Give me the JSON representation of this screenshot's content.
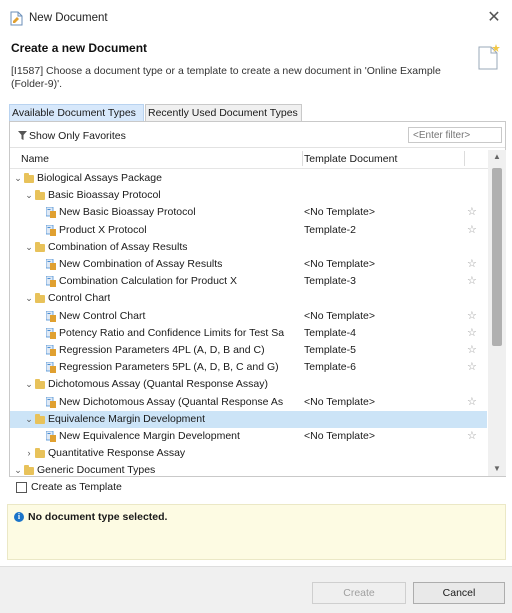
{
  "window": {
    "title": "New Document",
    "close_glyph": "✕"
  },
  "header": {
    "title": "Create a new Document",
    "description": "[I1587] Choose a document type or a template to create a new document in 'Online Example (Folder-9)'."
  },
  "tabs": [
    {
      "label": "Available Document Types",
      "active": true
    },
    {
      "label": "Recently Used Document Types",
      "active": false
    }
  ],
  "favorites": {
    "label": "Show Only Favorites",
    "filter_placeholder": "<Enter filter>"
  },
  "columns": {
    "name": "Name",
    "template": "Template Document"
  },
  "tree": [
    {
      "type": "folder",
      "level": 0,
      "label": "Biological Assays Package",
      "expanded": true
    },
    {
      "type": "folder",
      "level": 1,
      "label": "Basic Bioassay Protocol",
      "expanded": true
    },
    {
      "type": "doc",
      "level": 2,
      "label": "New Basic Bioassay Protocol",
      "template": "<No Template>",
      "star": "☆"
    },
    {
      "type": "doc",
      "level": 2,
      "label": "Product X Protocol",
      "template": "Template-2",
      "star": "☆"
    },
    {
      "type": "folder",
      "level": 1,
      "label": "Combination of Assay Results",
      "expanded": true
    },
    {
      "type": "doc",
      "level": 2,
      "label": "New Combination of Assay Results",
      "template": "<No Template>",
      "star": "☆"
    },
    {
      "type": "doc",
      "level": 2,
      "label": "Combination Calculation for Product X",
      "template": "Template-3",
      "star": "☆"
    },
    {
      "type": "folder",
      "level": 1,
      "label": "Control Chart",
      "expanded": true
    },
    {
      "type": "doc",
      "level": 2,
      "label": "New Control Chart",
      "template": "<No Template>",
      "star": "☆"
    },
    {
      "type": "doc",
      "level": 2,
      "label": "Potency Ratio and Confidence Limits for Test Sa",
      "template": "Template-4",
      "star": "☆"
    },
    {
      "type": "doc",
      "level": 2,
      "label": "Regression Parameters 4PL (A, D, B and C)",
      "template": "Template-5",
      "star": "☆"
    },
    {
      "type": "doc",
      "level": 2,
      "label": "Regression Parameters 5PL (A, D, B, C and G)",
      "template": "Template-6",
      "star": "☆"
    },
    {
      "type": "folder",
      "level": 1,
      "label": "Dichotomous Assay (Quantal Response Assay)",
      "expanded": true
    },
    {
      "type": "doc",
      "level": 2,
      "label": "New Dichotomous Assay (Quantal Response As",
      "template": "<No Template>",
      "star": "☆"
    },
    {
      "type": "folder",
      "level": 1,
      "label": "Equivalence Margin Development",
      "expanded": true,
      "selected": true
    },
    {
      "type": "doc",
      "level": 2,
      "label": "New Equivalence Margin Development",
      "template": "<No Template>",
      "star": "☆"
    },
    {
      "type": "folder",
      "level": 1,
      "label": "Quantitative Response Assay",
      "expanded": false
    },
    {
      "type": "folder",
      "level": 0,
      "label": "Generic Document Types",
      "expanded": true
    }
  ],
  "glyphs": {
    "expanded": "⌄",
    "collapsed": "›",
    "scroll_up": "▲",
    "scroll_down": "▼",
    "info": "i"
  },
  "icons": {
    "doc_colors": [
      "#4a8fd4",
      "#e0a030",
      "#6aa84f"
    ]
  },
  "create_as_template": {
    "label": "Create as Template",
    "checked": false
  },
  "message": {
    "text": "No document type selected."
  },
  "buttons": {
    "create": "Create",
    "cancel": "Cancel"
  }
}
